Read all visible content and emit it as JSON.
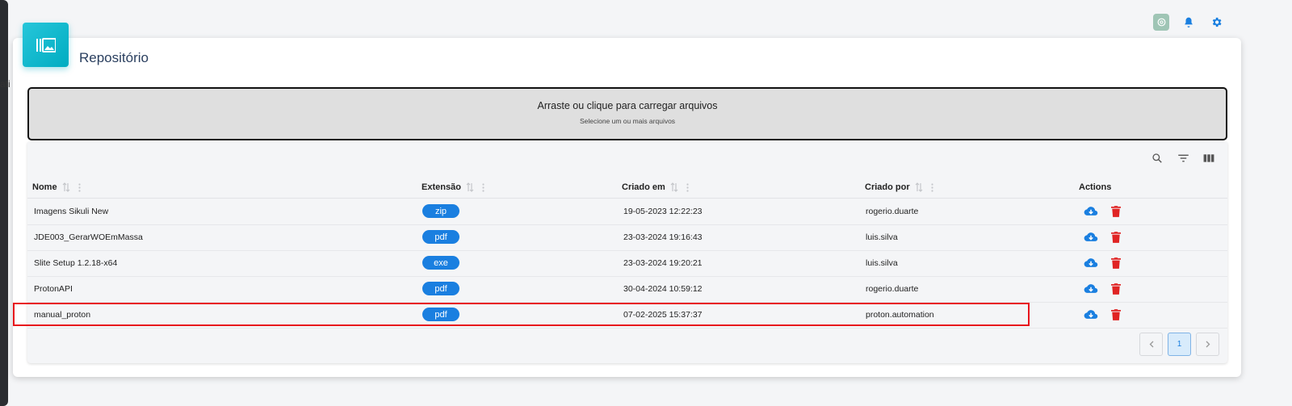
{
  "left_stub_text": "ati",
  "topbar": {
    "icons": [
      "chatgpt-icon",
      "bell-icon",
      "gear-icon"
    ]
  },
  "card": {
    "title": "Repositório",
    "badge_icon": "gallery-icon"
  },
  "dropzone": {
    "title": "Arraste ou clique para carregar arquivos",
    "subtitle": "Selecione um ou mais arquivos"
  },
  "toolbar": {
    "icons": [
      "search-icon",
      "filter-icon",
      "columns-icon"
    ]
  },
  "table": {
    "headers": {
      "name": "Nome",
      "extension": "Extensão",
      "created_at": "Criado em",
      "created_by": "Criado por",
      "actions": "Actions"
    },
    "rows": [
      {
        "name": "Imagens Sikuli New",
        "extension": "zip",
        "created_at": "19-05-2023 12:22:23",
        "created_by": "rogerio.duarte"
      },
      {
        "name": "JDE003_GerarWOEmMassa",
        "extension": "pdf",
        "created_at": "23-03-2024 19:16:43",
        "created_by": "luis.silva"
      },
      {
        "name": "Slite Setup 1.2.18-x64",
        "extension": "exe",
        "created_at": "23-03-2024 19:20:21",
        "created_by": "luis.silva"
      },
      {
        "name": "ProtonAPI",
        "extension": "pdf",
        "created_at": "30-04-2024 10:59:12",
        "created_by": "rogerio.duarte"
      },
      {
        "name": "manual_proton",
        "extension": "pdf",
        "created_at": "07-02-2025 15:37:37",
        "created_by": "proton.automation"
      }
    ],
    "highlighted_row": 4
  },
  "pagination": {
    "current_page": "1"
  },
  "colors": {
    "accent": "#1a7fe0",
    "badge": "#00acc1",
    "delete": "#e02424",
    "highlight": "#e8141c"
  }
}
